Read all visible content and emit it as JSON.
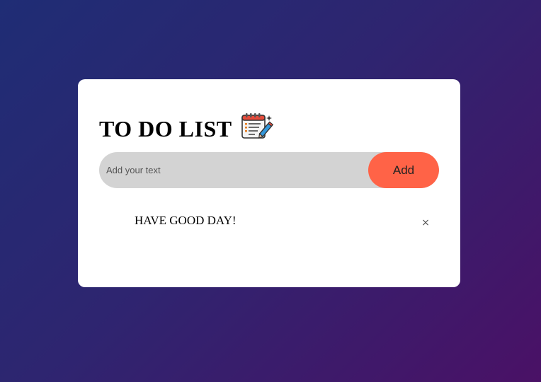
{
  "app": {
    "title": "TO DO LIST",
    "title_icon": "notepad-pencil-icon"
  },
  "input": {
    "placeholder": "Add your text",
    "value": ""
  },
  "add_button": {
    "label": "Add"
  },
  "tasks": [
    {
      "text": "HAVE GOOD DAY!",
      "close_symbol": "×"
    }
  ],
  "colors": {
    "background_start": "#1f2d75",
    "background_end": "#4a1166",
    "card": "#ffffff",
    "input_bg": "#d3d3d3",
    "add_button": "#ff6347"
  }
}
